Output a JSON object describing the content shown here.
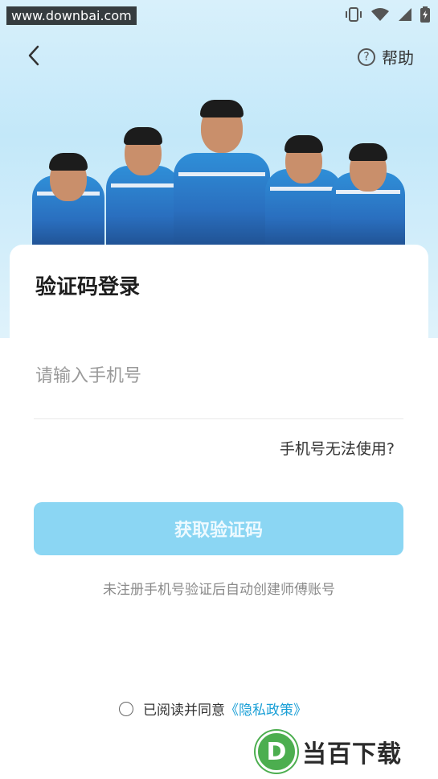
{
  "watermark_top": "www.downbai.com",
  "nav": {
    "help_label": "帮助"
  },
  "login": {
    "title": "验证码登录",
    "phone_placeholder": "请输入手机号",
    "phone_unavailable": "手机号无法使用?",
    "get_code_label": "获取验证码",
    "hint": "未注册手机号验证后自动创建师傅账号"
  },
  "agreement": {
    "prefix": "已阅读并同意",
    "policy_link": "《隐私政策》"
  },
  "watermark_bottom": {
    "logo_letter": "D",
    "text": "当百下载"
  },
  "colors": {
    "accent": "#1a9fd6",
    "button_disabled": "#8bd6f3",
    "hero_bg": "#c3e8f9"
  },
  "icons": [
    "back-arrow-icon",
    "help-circle-icon",
    "vibrate-icon",
    "wifi-icon",
    "signal-icon",
    "battery-icon"
  ]
}
